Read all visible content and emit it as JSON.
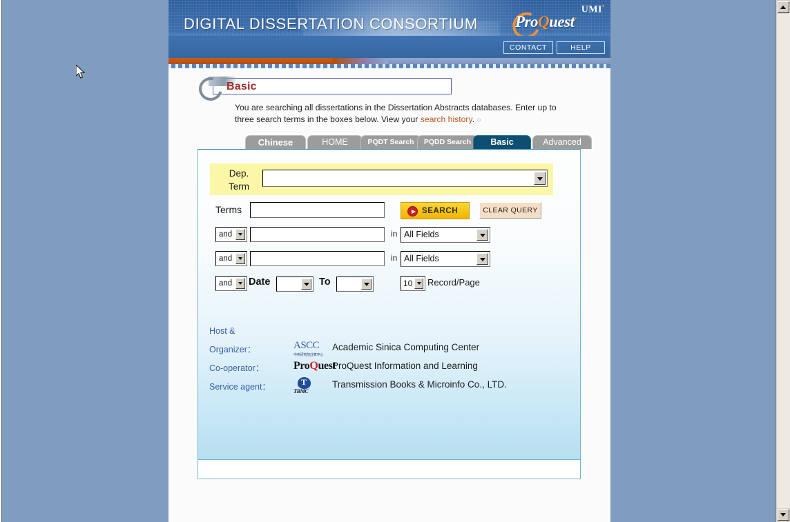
{
  "header": {
    "title": "DIGITAL DISSERTATION CONSORTIUM",
    "umi_label": "UMI",
    "umi_mark": "•",
    "proquest_pro": "Pro",
    "proquest_q": "Q",
    "proquest_uest": "uest",
    "proquest_mark": "•",
    "contact_label": "CONTACT",
    "help_label": "HELP"
  },
  "page_title": {
    "label": "Basic"
  },
  "intro": {
    "line1": "You are searching all dissertations in the Dissertation Abstracts databases. Enter up to",
    "line2_before": "three search terms in the boxes below. View your ",
    "link": "search history",
    "line2_after": ".",
    "bullet": "○"
  },
  "tabs": [
    {
      "label": "Chinese",
      "active": false
    },
    {
      "label": "HOME",
      "active": false
    },
    {
      "label": "PQDT Search",
      "active": false
    },
    {
      "label": "PQDD Search",
      "active": false
    },
    {
      "label": "Basic",
      "active": true
    },
    {
      "label": "Advanced",
      "active": false
    }
  ],
  "form": {
    "dep_term_label_line1": "Dep.",
    "dep_term_label_line2": "Term",
    "dep_term_value": "",
    "terms_label": "Terms",
    "terms_value": "",
    "search_button": "SEARCH",
    "clear_button": "CLEAR QUERY",
    "in_label": "in",
    "rows": [
      {
        "operator": "and",
        "value": "",
        "field": "All Fields"
      },
      {
        "operator": "and",
        "value": "",
        "field": "All Fields"
      }
    ],
    "date_row": {
      "operator": "and",
      "date_label": "Date",
      "from_value": "",
      "to_label": "To",
      "to_value": ""
    },
    "records_per_page": "10",
    "records_label": "Record/Page"
  },
  "credits": [
    {
      "label_line1": "Host &",
      "label_line2": "Organizer：",
      "logo": "ASCC",
      "logo_sub": "中央研究院計算中心",
      "text": "Academic Sinica Computing Center"
    },
    {
      "label_line1": "",
      "label_line2": "Co-operator：",
      "logo": "ProQuest",
      "logo_sub": "",
      "text": "ProQuest Information and Learning"
    },
    {
      "label_line1": "",
      "label_line2": "Service agent：",
      "logo": "TBMC",
      "logo_sub": "",
      "text": "Transmission Books & Microinfo Co., LTD."
    }
  ],
  "colors": {
    "desktop_blue": "#7f9dbf",
    "banner_blue": "#3d6fae",
    "accent_orange": "#c85c1c",
    "title_red": "#a02b2b",
    "tab_active": "#0e4e72",
    "highlight_yellow": "#fbf7a6",
    "search_gold": "#f8c417",
    "clear_peach": "#f6ddc6",
    "link_orange": "#b8571f",
    "credit_label_blue": "#3b5ea8"
  }
}
